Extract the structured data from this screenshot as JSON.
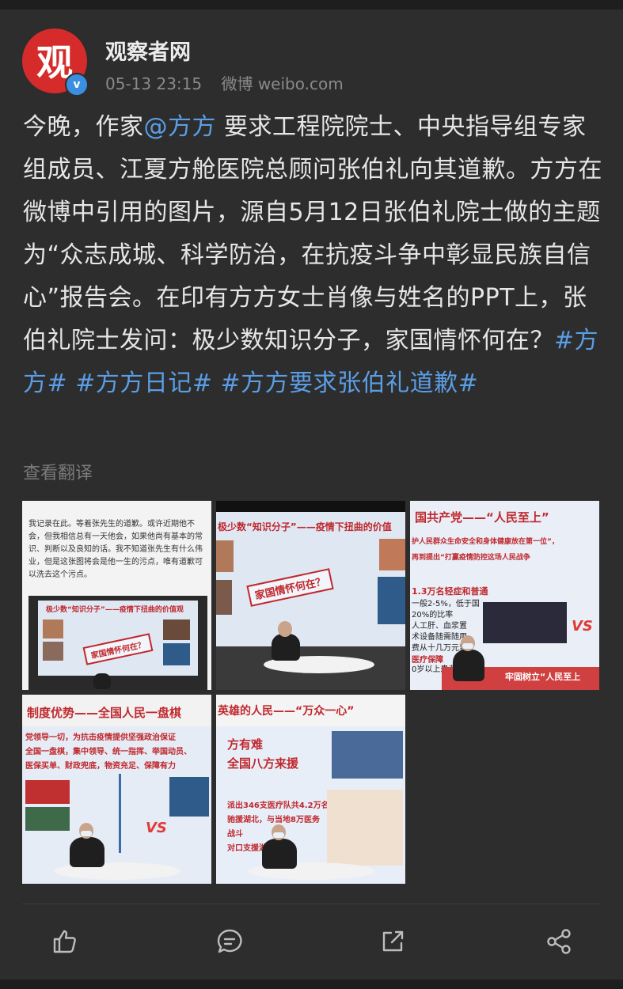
{
  "post": {
    "author": "观察者网",
    "avatar_char": "观",
    "timestamp": "05-13 23:15",
    "source": "微博 weibo.com",
    "text_segments": [
      {
        "text": "今晚，作家",
        "link": false
      },
      {
        "text": "@方方",
        "link": true
      },
      {
        "text": " 要求工程院院士、中央指导组专家组成员、江夏方舱医院总顾问张伯礼向其道歉。方方在微博中引用的图片，源自5月12日张伯礼院士做的主题为“众志成城、科学防治，在抗疫斗争中彰显民族自信心”报告会。在印有方方女士肖像与姓名的PPT上，张伯礼院士发问：极少数知识分子，家国情怀何在？",
        "link": false
      },
      {
        "text": "#方方#",
        "link": true
      },
      {
        "text": " ",
        "link": false
      },
      {
        "text": "#方方日记#",
        "link": true
      },
      {
        "text": " ",
        "link": false
      },
      {
        "text": "#方方要求张伯礼道歉#",
        "link": true
      }
    ],
    "translate_label": "查看翻译"
  },
  "images": {
    "img1": {
      "quote": "我记录在此。等着张先生的道歉。或许近期他不会，但我相信总有一天他会，如果他尚有基本的常识、判断以及良知的话。我不知道张先生有什么伟业，但是这张图将会是他一生的污点，唯有道歉可以洗去这个污点。",
      "slide_title": "极少数“知识分子”——疫情下扭曲的价值观",
      "stamp": "家国情怀何在？"
    },
    "img2": {
      "slide_title": "极少数“知识分子”——疫情下扭曲的价值",
      "stamp": "家国情怀何在？"
    },
    "img3": {
      "slide_title": "国共产党——“人民至上”",
      "lines": [
        "护人民群众生命安全和身体健康放在第一位”，",
        "再到提出“打赢疫情防控这场人民战争",
        "1.3万名轻症和普通",
        "一般2-5%，低于国",
        "20%的比率",
        "人工肝、血浆置",
        "术设备随需随用",
        "费从十几万元到",
        "医疗保障",
        "0岁以上患者"
      ],
      "vs": "VS",
      "banner": "牢固树立“人民至上"
    },
    "img4": {
      "slide_title": "制度优势——全国人民一盘棋",
      "lines": [
        "党领导一切，为抗击疫情提供坚强政治保证",
        "全国一盘棋，集中领导、统一指挥、举国动员、",
        "医保买单、财政兜底，物资充足、保障有力"
      ],
      "vs": "VS"
    },
    "img5": {
      "slide_title": "英雄的人民——“万众一心”",
      "lines": [
        "方有难",
        "全国八方来援",
        "派出346支医疗队共4.2万名",
        "驰援湖北，与当地8万医务",
        "战斗",
        "对口支援湖"
      ]
    }
  },
  "actions": {
    "like": "thumbs-up-icon",
    "comment": "comment-icon",
    "repost": "repost-icon",
    "share": "share-icon"
  },
  "colors": {
    "background": "#2d2d2d",
    "link": "#5b9ee6",
    "avatar": "#d52b2b",
    "verified": "#3a8fe0",
    "slide_red": "#c0282d"
  }
}
